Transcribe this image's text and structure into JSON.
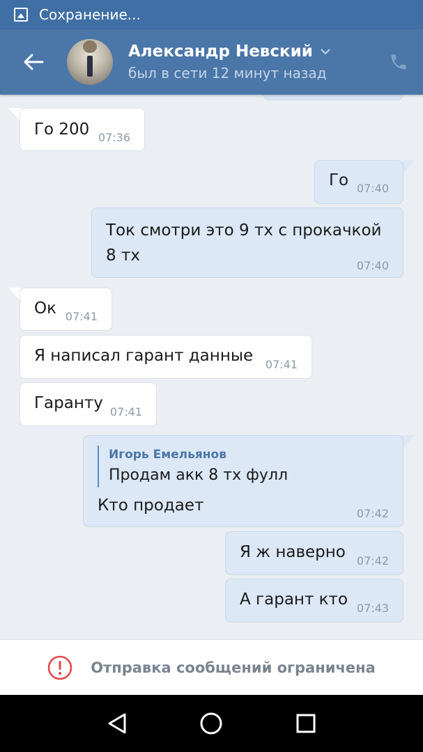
{
  "status_bar": {
    "text": "Сохранение...",
    "icon": "image-save-icon"
  },
  "header": {
    "name": "Александр Невский",
    "status": "был в сети 12 минут назад",
    "back_icon": "back-arrow-icon",
    "call_icon": "phone-icon",
    "dropdown_icon": "chevron-down-icon"
  },
  "messages": [
    {
      "dir": "in",
      "text": "Го 200",
      "time": "07:36"
    },
    {
      "dir": "out",
      "text": "Го",
      "time": "07:40"
    },
    {
      "dir": "out",
      "text_line1": "Ток смотри это 9 тх с прокачкой",
      "text_line2": "8 тх",
      "time": "07:40"
    },
    {
      "dir": "in",
      "text": "Ок",
      "time": "07:41"
    },
    {
      "dir": "in",
      "text": "Я написал гарант данные",
      "time": "07:41"
    },
    {
      "dir": "in",
      "text": "Гаранту",
      "time": "07:41"
    },
    {
      "dir": "out",
      "quote_author": "Игорь Емельянов",
      "quote_text": "Продам акк 8 тх фулл",
      "text": "Кто продает",
      "time": "07:42"
    },
    {
      "dir": "out",
      "text": "Я ж наверно",
      "time": "07:42"
    },
    {
      "dir": "out",
      "text": "А гарант кто",
      "time": "07:43"
    }
  ],
  "restricted": {
    "text": "Отправка сообщений ограничена",
    "icon": "alert-circle-icon"
  },
  "navbar": {
    "back": "nav-back-icon",
    "home": "nav-home-icon",
    "recents": "nav-recents-icon"
  },
  "colors": {
    "header": "#4a76a8",
    "statusbar": "#3f6fa5",
    "bg": "#ebeef2",
    "out_bubble": "#dce8f6",
    "in_bubble": "#ffffff",
    "alert": "#e64646"
  }
}
